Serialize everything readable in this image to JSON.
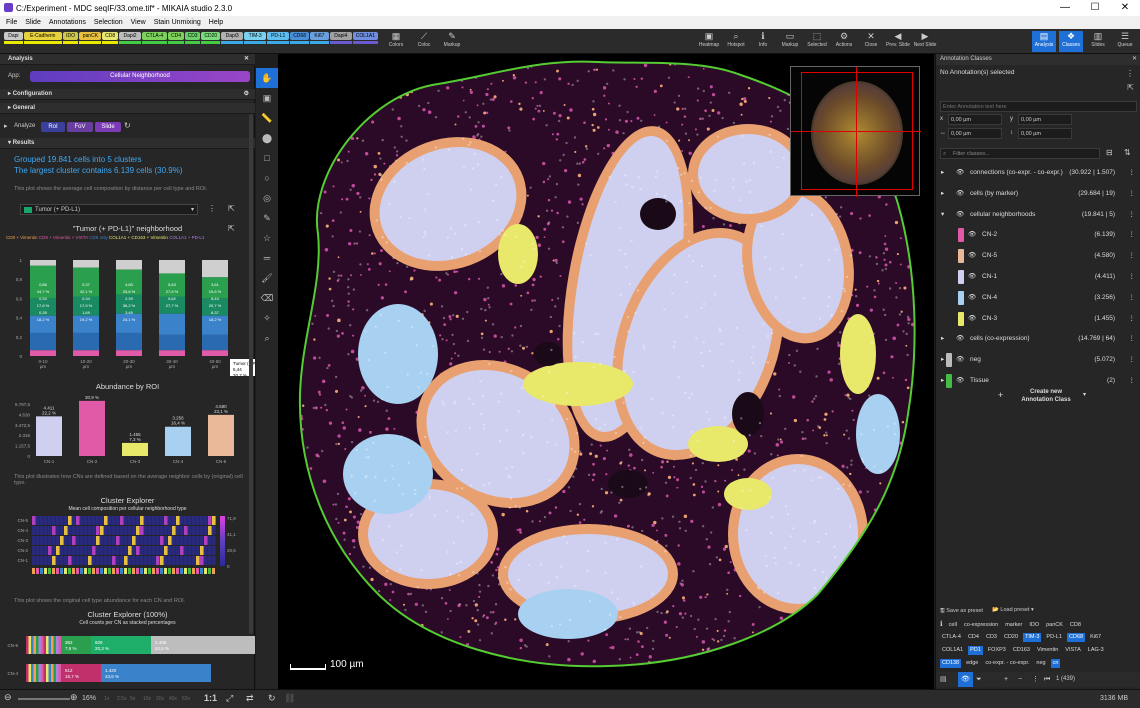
{
  "window": {
    "title": "C:/Experiment - MDC seqIF/33.ome.tif* - MIKAIA studio 2.3.0",
    "min": "—",
    "max": "☐",
    "close": "✕"
  },
  "menu": [
    "File",
    "Slide",
    "Annotations",
    "Selection",
    "View",
    "Stain Unmixing",
    "Help"
  ],
  "markers": [
    {
      "label": "Dapi",
      "color": "#c9c9c9",
      "bar": "#e8e800"
    },
    {
      "label": "E-Cadherin",
      "color": "#e8d23c",
      "bar": "#e8e800"
    },
    {
      "label": "IDO",
      "color": "#d0c84a",
      "bar": "#e8e800"
    },
    {
      "label": "panCK",
      "color": "#e8c040",
      "bar": "#e8e800"
    },
    {
      "label": "CD8",
      "color": "#e8e870",
      "bar": "#e8e800"
    },
    {
      "label": "Dapi2",
      "color": "#bcbcbc",
      "bar": "#44cc44"
    },
    {
      "label": "CTLA-4",
      "color": "#7ad25a",
      "bar": "#44cc44"
    },
    {
      "label": "CD4",
      "color": "#7ed25c",
      "bar": "#44cc44"
    },
    {
      "label": "CD3",
      "color": "#6ad06a",
      "bar": "#44cc44"
    },
    {
      "label": "CD20",
      "color": "#7adb7a",
      "bar": "#44cc44"
    },
    {
      "label": "Dapi3",
      "color": "#b0b0b0",
      "bar": "#3aa9e6"
    },
    {
      "label": "TIM-3",
      "color": "#7bd1f0",
      "bar": "#3aa9e6"
    },
    {
      "label": "PD-L1",
      "color": "#5fbef0",
      "bar": "#3aa9e6"
    },
    {
      "label": "CD68",
      "color": "#4a90d9",
      "bar": "#3aa9e6"
    },
    {
      "label": "Ki67",
      "color": "#6aa0e0",
      "bar": "#3aa9e6"
    },
    {
      "label": "Dapi4",
      "color": "#a0a0a0",
      "bar": "#6a5ad0"
    },
    {
      "label": "COL1A1",
      "color": "#6f8ee0",
      "bar": "#6a5ad0"
    }
  ],
  "toolbar": {
    "left": [
      {
        "label": "Colors",
        "icon": "▦"
      },
      {
        "label": "Coloc",
        "icon": "⟋"
      },
      {
        "label": "Markup",
        "icon": "✎"
      }
    ],
    "center": [
      {
        "label": "Heatmap",
        "icon": "▣"
      },
      {
        "label": "Hotspot",
        "icon": "⌕"
      },
      {
        "label": "Info",
        "icon": "ℹ"
      },
      {
        "label": "Markup",
        "icon": "▭"
      },
      {
        "label": "Selected",
        "icon": "⬚"
      },
      {
        "label": "Actions",
        "icon": "⚙"
      },
      {
        "label": "Close",
        "icon": "✕"
      },
      {
        "label": "Prev. Slide",
        "icon": "◀"
      },
      {
        "label": "Next Slide",
        "icon": "▶"
      }
    ],
    "right": [
      {
        "label": "Analysis",
        "icon": "▤"
      },
      {
        "label": "Classes",
        "icon": "❖"
      },
      {
        "label": "Slides",
        "icon": "▥"
      },
      {
        "label": "Queue",
        "icon": "☰"
      }
    ]
  },
  "analysis": {
    "header": "Analysis",
    "app_label": "App:",
    "app_value": "Cellular Neighborhood",
    "configuration": "Configuration",
    "general": "General",
    "analyze_label": "Analyze",
    "analyze_opts": [
      "RoI",
      "FoV",
      "Slide"
    ],
    "results": "Results",
    "summary1": "Grouped 19.841 cells into 5 clusters",
    "summary2": "The largest cluster contains 6.139 cells (30.9%)",
    "desc1": "This plot shows the average cell composition by distance per cell type and ROI.",
    "dropdown": "Tumor (+ PD-L1)",
    "neighborhood_title": "\"Tumor (+ PD-L1)\" neighborhood",
    "legend": [
      "CD8 + Vimentin",
      "CD8 + Vimentin + VISTA",
      "CD8 only",
      "COL1A1 + CD163 + Vimentin",
      "COL1A1 + PD-L1"
    ],
    "abundance_title": "Abundance by ROI",
    "desc2": "This plot illustrates how CNs are defined based on the average neighbor cells by (original) cell type.",
    "explorer_title": "Cluster Explorer",
    "explorer_sub": "Mean cell composition per cellular neighborhood type",
    "explorer_rows": [
      "CN-5",
      "CN-4",
      "CN-3",
      "CN-2",
      "CN-1"
    ],
    "explorer_scale": [
      "71,9",
      "41,1",
      "20,5",
      "0"
    ],
    "desc3": "This plot shows the original cell type abundance for each CN and ROI.",
    "explorer100_title": "Cluster Explorer (100%)",
    "explorer100_sub": "Cell counts per CN as stacked percentages",
    "stack_rows": [
      {
        "name": "CN-5",
        "segs": [
          {
            "v": "362",
            "p": "7,9 %",
            "c": "#2aa04f",
            "w": 30
          },
          {
            "v": "929",
            "p": "20,3 %",
            "c": "#1fae6a",
            "w": 60
          },
          {
            "v": "2.406",
            "p": "52,6 %",
            "c": "#bdbdbd",
            "w": 135
          }
        ]
      },
      {
        "name": "CN-4",
        "segs": [
          {
            "v": "512",
            "p": "15,7 %",
            "c": "#c0306a",
            "w": 40
          },
          {
            "v": "1.420",
            "p": "43,6 %",
            "c": "#3a82c9",
            "w": 110
          }
        ]
      }
    ]
  },
  "chart_data": [
    {
      "type": "bar",
      "title": "\"Tumor (+ PD-L1)\" neighborhood",
      "categories": [
        "0-10 µm",
        "10-20 µm",
        "20-30 µm",
        "30-40 µm",
        "40-50 µm"
      ],
      "series": [
        {
          "name": "COL1A1 + CD163 + Vimentin",
          "values": [
            0.86,
            0.37,
            0.3,
            0.5,
            0.44
          ],
          "labels": [
            "44,7 %",
            "42,1 %",
            "36,3 %",
            "27,8 %",
            "20,7 %"
          ]
        },
        {
          "name": "CD8 only",
          "values": [
            0.34,
            0.35,
            0.39,
            0.62,
            0.37
          ],
          "labels": [
            "17,6 %",
            "17,9 %",
            "24,1 %",
            "27,7 %",
            "20,7 %"
          ]
        },
        {
          "name": "CD8 + Vimentin",
          "values": [
            0.35,
            0.33,
            0.3,
            0.24,
            0.22
          ],
          "labels": [
            "18,2 %",
            "18,2 %",
            "18,2 %",
            "18,2 %",
            "18,2 %"
          ]
        }
      ],
      "value_labels": [
        [
          "0,86",
          "44,7 %",
          "0,34",
          "17,6 %",
          "0,35",
          "18,2 %"
        ],
        [
          "0,37",
          "42,1 %",
          "0,34",
          "17,9 %",
          "1,69",
          "19,2 %"
        ],
        [
          "4,80",
          "33,6 %",
          "2,39",
          "36,2 %",
          "3,45",
          "24,1 %"
        ],
        [
          "5,63",
          "27,8 %",
          "5,62",
          "27,7 %"
        ],
        [
          "3,61",
          "19,6 %",
          "8,44",
          "20,7 %",
          "8,37",
          "18,2 %"
        ]
      ],
      "tooltip": [
        "Tumor (+ PD-L1)",
        "5,44",
        "20,7 %"
      ]
    },
    {
      "type": "bar",
      "title": "Abundance by ROI",
      "categories": [
        "CN-1",
        "CN-2",
        "CN-3",
        "CN-4",
        "CN-5"
      ],
      "values": [
        4411,
        6139,
        1455,
        3256,
        4580
      ],
      "labels": [
        "22,2 %",
        "30,9 %",
        "7,3 %",
        "16,4 %",
        "23,1 %"
      ],
      "colors": [
        "#cfd0f0",
        "#e05aa8",
        "#e8e86a",
        "#a8d0f0",
        "#e8b898"
      ],
      "yticks": [
        "5.787,5",
        "4.630",
        "3.472,5",
        "2.315",
        "1.157,5",
        "0"
      ],
      "ylim": [
        0,
        5787.5
      ]
    }
  ],
  "canvas": {
    "scale": "100 µm"
  },
  "annotations": {
    "header": "Annotation Classes",
    "selected": "No Annotation(s) selected",
    "placeholder": "Enter Annotation text here",
    "coords": [
      {
        "k": "x",
        "v": "0,00 µm"
      },
      {
        "k": "y",
        "v": "0,00 µm"
      },
      {
        "k": "↔",
        "v": "0,00 µm"
      },
      {
        "k": "↕",
        "v": "0,00 µm"
      }
    ],
    "filter": "Filter classes...",
    "classes": [
      {
        "name": "connections (co-expr. - co-expr.)",
        "count": "(30.922 | 1.507)",
        "color": null,
        "indent": 0
      },
      {
        "name": "cells (by marker)",
        "count": "(29.684 | 19)",
        "color": null,
        "indent": 0
      },
      {
        "name": "cellular neighborhoods",
        "count": "(19.841 | 5)",
        "color": null,
        "indent": 0
      },
      {
        "name": "CN-2",
        "count": "(6.139)",
        "color": "#e05aa8",
        "indent": 1
      },
      {
        "name": "CN-5",
        "count": "(4.580)",
        "color": "#e8b898",
        "indent": 1
      },
      {
        "name": "CN-1",
        "count": "(4.411)",
        "color": "#cfd0f0",
        "indent": 1
      },
      {
        "name": "CN-4",
        "count": "(3.256)",
        "color": "#a8d0f0",
        "indent": 1
      },
      {
        "name": "CN-3",
        "count": "(1.455)",
        "color": "#e8e86a",
        "indent": 1
      },
      {
        "name": "cells (co-expression)",
        "count": "(14.769 | 64)",
        "color": null,
        "indent": 0
      },
      {
        "name": "neg",
        "count": "(5.072)",
        "color": "#bbbbbb",
        "indent": 0
      },
      {
        "name": "Tissue",
        "count": "(2)",
        "color": "#44bb44",
        "indent": 0
      }
    ],
    "create": "Create new Annotation Class",
    "save_preset": "Save as preset",
    "load_preset": "Load preset",
    "tags1": [
      "cell",
      "co-expression",
      "marker",
      "IDO",
      "panCK",
      "CD8"
    ],
    "tags2": [
      "CTLA-4",
      "CD4",
      "CD3",
      "CD20",
      "TIM-3",
      "PD-L1",
      "CD68",
      "Ki67"
    ],
    "tags3": [
      "COL1A1",
      "PD1",
      "FOXP3",
      "CD163",
      "Vimentin",
      "VISTA",
      "LAG-3"
    ],
    "tags4": [
      "CD138",
      "edge",
      "co-expr. - co-expr.",
      "neg",
      "cn"
    ],
    "selected_tags": [
      "TIM-3",
      "CD68",
      "PD1",
      "CD138",
      "cn"
    ],
    "pager": "1 (439)"
  },
  "status": {
    "zoom": "16%",
    "zooms": [
      "1x",
      "2.5x",
      "5x",
      "10x",
      "20x",
      "40x",
      "63x"
    ],
    "ratio": "1:1",
    "memory": "3136 MB"
  }
}
